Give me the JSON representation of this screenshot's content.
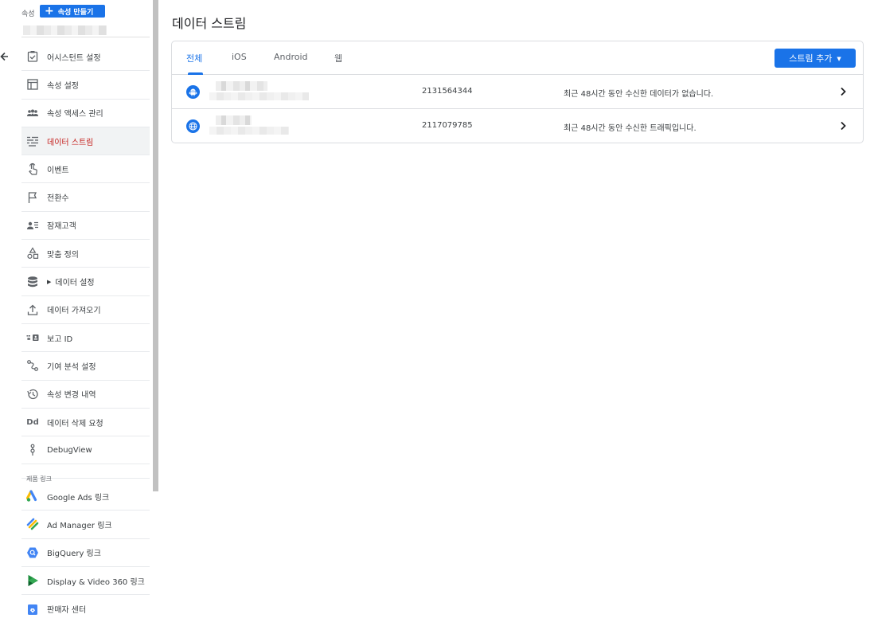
{
  "sidebar": {
    "property_label": "속성",
    "create_property_button": "속성 만들기",
    "items": [
      {
        "label": "어시스턴트 설정",
        "icon": "assistant-check-icon"
      },
      {
        "label": "속성 설정",
        "icon": "property-settings-icon"
      },
      {
        "label": "속성 액세스 관리",
        "icon": "people-icon"
      },
      {
        "label": "데이터 스트림",
        "icon": "data-streams-icon",
        "active": true
      },
      {
        "label": "이벤트",
        "icon": "touch-icon"
      },
      {
        "label": "전환수",
        "icon": "flag-icon"
      },
      {
        "label": "잠재고객",
        "icon": "audience-icon"
      },
      {
        "label": "맞춤 정의",
        "icon": "shapes-icon"
      },
      {
        "label": "데이터 설정",
        "icon": "database-icon",
        "expandable": true
      },
      {
        "label": "데이터 가져오기",
        "icon": "upload-icon"
      },
      {
        "label": "보고 ID",
        "icon": "reporting-id-icon"
      },
      {
        "label": "기여 분석 설정",
        "icon": "attribution-icon"
      },
      {
        "label": "속성 변경 내역",
        "icon": "history-icon"
      },
      {
        "label": "데이터 삭제 요청",
        "icon": "data-deletion-icon",
        "icon_text": "Dd"
      },
      {
        "label": "DebugView",
        "icon": "debug-icon"
      }
    ],
    "product_links_label": "제품 링크",
    "product_links": [
      {
        "label": "Google Ads 링크",
        "icon": "google-ads-icon"
      },
      {
        "label": "Ad Manager 링크",
        "icon": "ad-manager-icon"
      },
      {
        "label": "BigQuery 링크",
        "icon": "bigquery-icon"
      },
      {
        "label": "Display & Video 360 링크",
        "icon": "display-video-icon"
      },
      {
        "label": "판매자 센터",
        "icon": "merchant-center-icon"
      }
    ]
  },
  "main": {
    "title": "데이터 스트림",
    "tabs": [
      {
        "label": "전체",
        "active": true
      },
      {
        "label": "iOS"
      },
      {
        "label": "Android"
      },
      {
        "label": "웹"
      }
    ],
    "add_stream_button": "스트림 추가",
    "streams": [
      {
        "type": "android",
        "icon": "android-icon",
        "id": "2131564344",
        "status": "최근 48시간 동안 수신한 데이터가 없습니다."
      },
      {
        "type": "web",
        "icon": "globe-icon",
        "id": "2117079785",
        "status": "최근 48시간 동안 수신한 트래픽입니다."
      }
    ]
  },
  "colors": {
    "accent": "#1a73e8",
    "active_nav_text": "#c5221f",
    "active_nav_bg": "#f1f3f4",
    "border": "#dadce0"
  }
}
